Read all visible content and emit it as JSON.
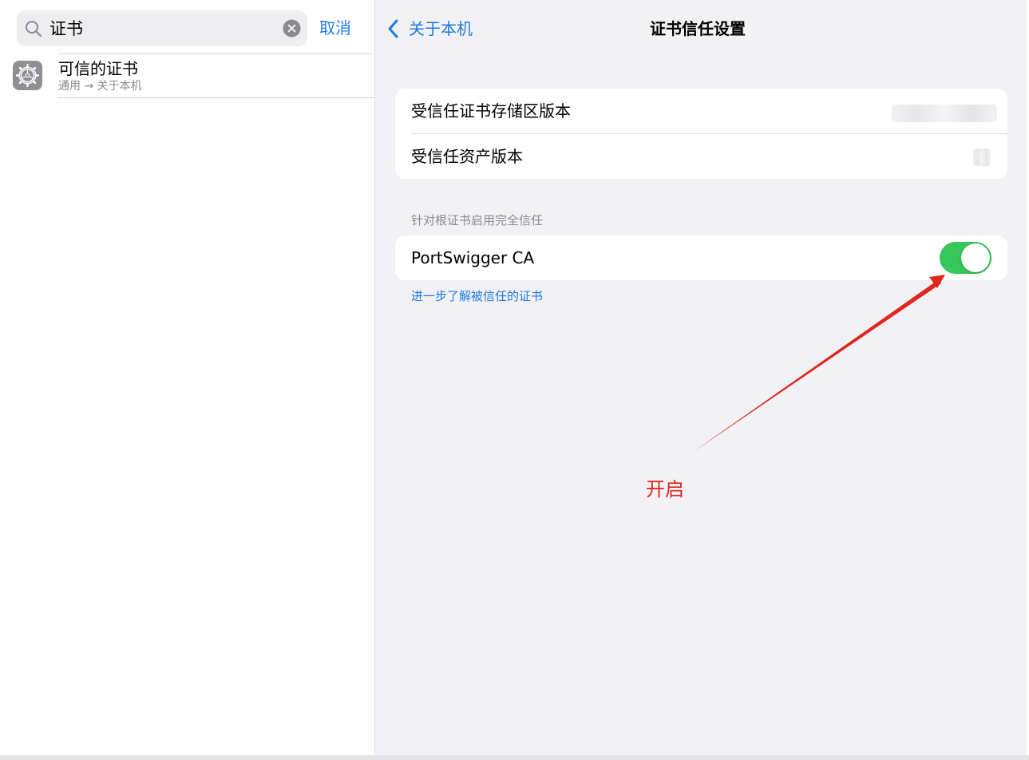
{
  "sidebar": {
    "search": {
      "value": "证书",
      "cancel_label": "取消"
    },
    "result": {
      "title": "可信的证书",
      "path": "通用 → 关于本机",
      "icon": "settings-gear-icon"
    }
  },
  "detail": {
    "back_label": "关于本机",
    "title": "证书信任设置",
    "rows": [
      {
        "label": "受信任证书存储区版本"
      },
      {
        "label": "受信任资产版本"
      }
    ],
    "section_header": "针对根证书启用完全信任",
    "certificate": {
      "name": "PortSwigger CA",
      "trust_enabled": true
    },
    "learn_more": "进一步了解被信任的证书"
  },
  "annotation": {
    "text": "开启",
    "color": "#e0261d"
  },
  "colors": {
    "accent": "#1f7ae0",
    "toggle_on": "#35c759",
    "grouped_background": "#f2f1f6",
    "secondary_text": "#8a8a8e"
  }
}
